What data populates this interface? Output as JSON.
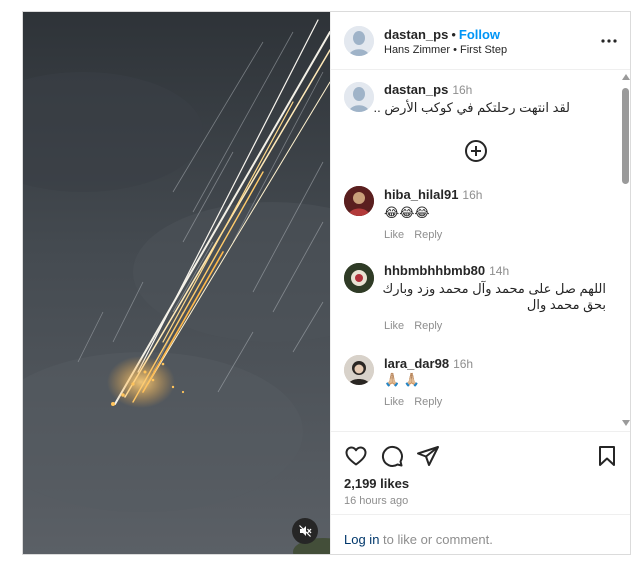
{
  "post": {
    "username": "dastan_ps",
    "follow_label": "Follow",
    "audio_artist": "Hans Zimmer",
    "audio_track": "First Step",
    "separator": "•"
  },
  "caption": {
    "username": "dastan_ps",
    "time": "16h",
    "text": "لقد انتهت رحلتكم في كوكب الأرض .."
  },
  "comments": [
    {
      "username": "hiba_hilal91",
      "time": "16h",
      "text": "😂😂😂",
      "like_label": "Like",
      "reply_label": "Reply"
    },
    {
      "username": "hhbmbhhbmb80",
      "time": "14h",
      "text_line1": "اللهم صل على محمد وآل محمد وزد وبارك",
      "text_line2": "بحق محمد وال",
      "like_label": "Like",
      "reply_label": "Reply"
    },
    {
      "username": "lara_dar98",
      "time": "16h",
      "text": "🙏🏼 🙏🏼",
      "like_label": "Like",
      "reply_label": "Reply"
    }
  ],
  "stats": {
    "likes": "2,199 likes",
    "time_ago": "16 hours ago"
  },
  "footer": {
    "login_link": "Log in",
    "login_rest": " to like or comment."
  },
  "icons": {
    "mute": "muted-speaker-icon",
    "more": "more-options-icon",
    "expand": "plus-circle-icon",
    "like": "heart-icon",
    "comment": "comment-bubble-icon",
    "share": "paper-plane-icon",
    "save": "bookmark-icon"
  },
  "colors": {
    "link": "#0095f6",
    "login_link": "#00376b",
    "muted_text": "#8e8e8e"
  }
}
